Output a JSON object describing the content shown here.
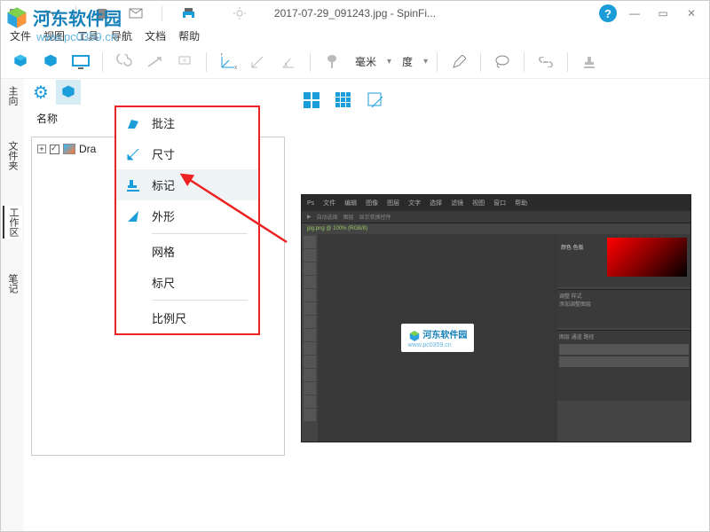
{
  "title": "2017-07-29_091243.jpg - SpinFi...",
  "menubar": [
    "文件",
    "视图",
    "工具",
    "导航",
    "文档",
    "帮助"
  ],
  "units": {
    "length": "毫米",
    "angle": "度"
  },
  "tree": {
    "header": "名称",
    "item": "Dra"
  },
  "dropdown": {
    "items": [
      {
        "label": "批注",
        "hover": false
      },
      {
        "label": "尺寸",
        "hover": false
      },
      {
        "label": "标记",
        "hover": true
      },
      {
        "label": "外形",
        "hover": false
      }
    ],
    "items2": [
      {
        "label": "网格"
      },
      {
        "label": "标尺"
      }
    ],
    "items3": [
      {
        "label": "比例尺"
      }
    ]
  },
  "sidebar": {
    "label1": "主向",
    "label2": "文件夹",
    "label3": "工作区",
    "label4": "笔记"
  },
  "watermark": {
    "brand": "河东软件园",
    "url": "www.pc0359.cn"
  },
  "preview_watermark": {
    "brand": "河东软件园",
    "url": "www.pc0359.cn"
  }
}
